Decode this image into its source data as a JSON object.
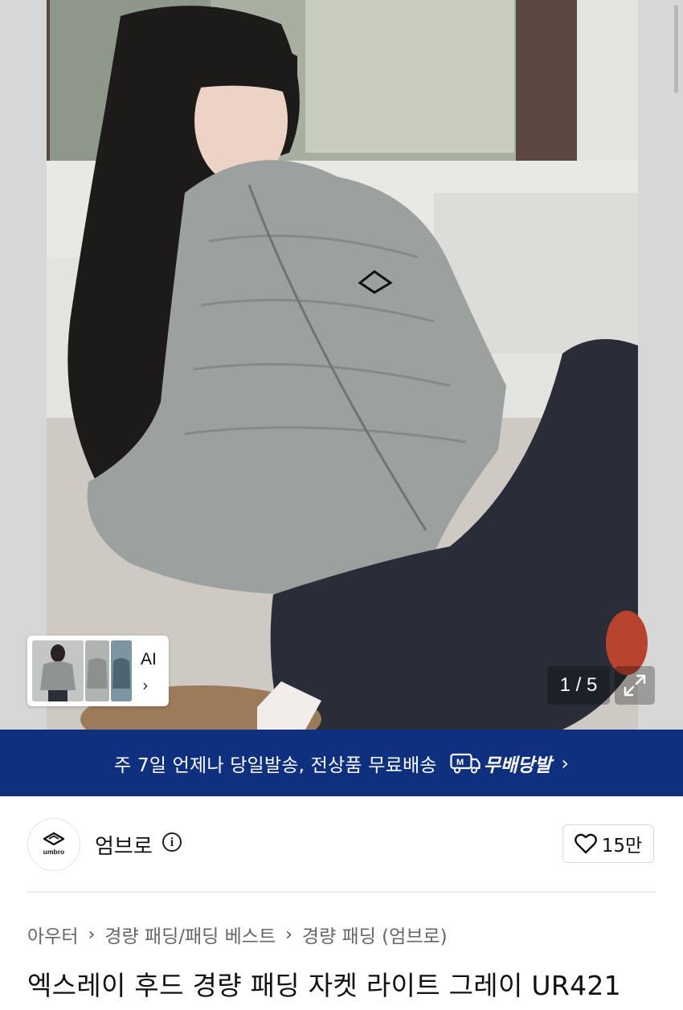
{
  "gallery": {
    "ai_label": "AI",
    "counter": "1 / 5",
    "current_image": 1,
    "total_images": 5
  },
  "shipping_banner": {
    "text": "주 7일 언제나 당일발송, 전상품 무료배송",
    "badge": "무배당발",
    "badge_icon": "M",
    "background": "#0f2f7f"
  },
  "brand": {
    "name": "엄브로",
    "logo_text": "umbro",
    "like_count": "15만"
  },
  "breadcrumb": [
    "아우터",
    "경량 패딩/패딩 베스트",
    "경량 패딩 (엄브로)"
  ],
  "product": {
    "title": "엑스레이 후드 경량 패딩 자켓 라이트 그레이 UR421"
  }
}
